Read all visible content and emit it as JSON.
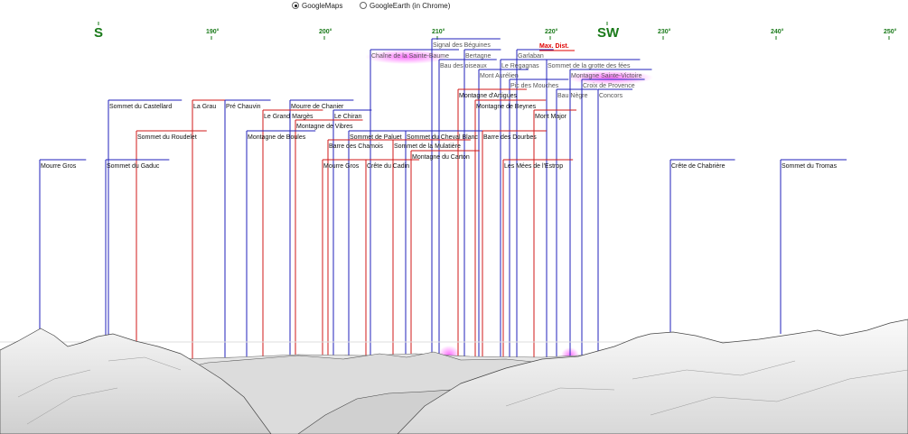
{
  "controls": {
    "option_googlemaps": "GoogleMaps",
    "option_googleearth": "GoogleEarth (in Chrome)",
    "selected": "GoogleMaps"
  },
  "compass": {
    "direction_labels": [
      "S",
      "SW"
    ],
    "degree_labels": [
      "190°",
      "200°",
      "210°",
      "220°",
      "230°",
      "240°",
      "250°"
    ],
    "max_distance_label": "Max. Dist."
  },
  "peaks": [
    {
      "name": "Signal des Béguines",
      "line": "blue",
      "style": "far"
    },
    {
      "name": "Chaîne de la Sainte-Baume",
      "line": "blue",
      "style": "far",
      "highlight": true
    },
    {
      "name": "Bertagne",
      "line": "blue",
      "style": "far"
    },
    {
      "name": "Garlaban",
      "line": "blue",
      "style": "far"
    },
    {
      "name": "Bau des oiseaux",
      "line": "blue",
      "style": "far"
    },
    {
      "name": "Le Regagnas",
      "line": "blue",
      "style": "far"
    },
    {
      "name": "Sommet de la grotte des fées",
      "line": "blue",
      "style": "far"
    },
    {
      "name": "Mont Aurélien",
      "line": "blue",
      "style": "far"
    },
    {
      "name": "Montagne Sainte-Victoire",
      "line": "blue",
      "style": "far",
      "highlight": true
    },
    {
      "name": "Pic des Mouches",
      "line": "blue",
      "style": "far"
    },
    {
      "name": "Croix de Provence",
      "line": "blue",
      "style": "far"
    },
    {
      "name": "Montagne d'Artigues",
      "line": "red",
      "style": "near"
    },
    {
      "name": "Bau Nègre",
      "line": "blue",
      "style": "far"
    },
    {
      "name": "Concors",
      "line": "blue",
      "style": "far"
    },
    {
      "name": "Sommet du Castellard",
      "line": "blue",
      "style": "near"
    },
    {
      "name": "La Grau",
      "line": "red",
      "style": "near"
    },
    {
      "name": "Pré Chauvin",
      "line": "blue",
      "style": "near"
    },
    {
      "name": "Mourre de Chanier",
      "line": "blue",
      "style": "near"
    },
    {
      "name": "Montagne de Beynes",
      "line": "red",
      "style": "near"
    },
    {
      "name": "Le Grand Margès",
      "line": "red",
      "style": "near"
    },
    {
      "name": "Le Chiran",
      "line": "blue",
      "style": "near"
    },
    {
      "name": "Mont Major",
      "line": "red",
      "style": "near"
    },
    {
      "name": "Montagne de Vibres",
      "line": "red",
      "style": "near"
    },
    {
      "name": "Sommet du Roudelet",
      "line": "red",
      "style": "near"
    },
    {
      "name": "Montagne de Boules",
      "line": "blue",
      "style": "near"
    },
    {
      "name": "Sommet de Paluet",
      "line": "blue",
      "style": "near"
    },
    {
      "name": "Sommet du Cheval Blanc",
      "line": "blue",
      "style": "near"
    },
    {
      "name": "Barre des Dourbes",
      "line": "red",
      "style": "near"
    },
    {
      "name": "Barre des Chamois",
      "line": "red",
      "style": "near"
    },
    {
      "name": "Sommet de la Mulatière",
      "line": "red",
      "style": "near"
    },
    {
      "name": "Montagne du Carton",
      "line": "red",
      "style": "near"
    },
    {
      "name": "Mourre Gros",
      "line": "blue",
      "style": "near"
    },
    {
      "name": "Sommet du Gaduc",
      "line": "blue",
      "style": "near"
    },
    {
      "name": "Mourre Gros",
      "line": "red",
      "style": "near"
    },
    {
      "name": "Crête du Cadin",
      "line": "red",
      "style": "near"
    },
    {
      "name": "Les Mées de l'Estrop",
      "line": "red",
      "style": "near"
    },
    {
      "name": "Crête de Chabrière",
      "line": "blue",
      "style": "near"
    },
    {
      "name": "Sommet du Tromas",
      "line": "blue",
      "style": "near"
    }
  ]
}
